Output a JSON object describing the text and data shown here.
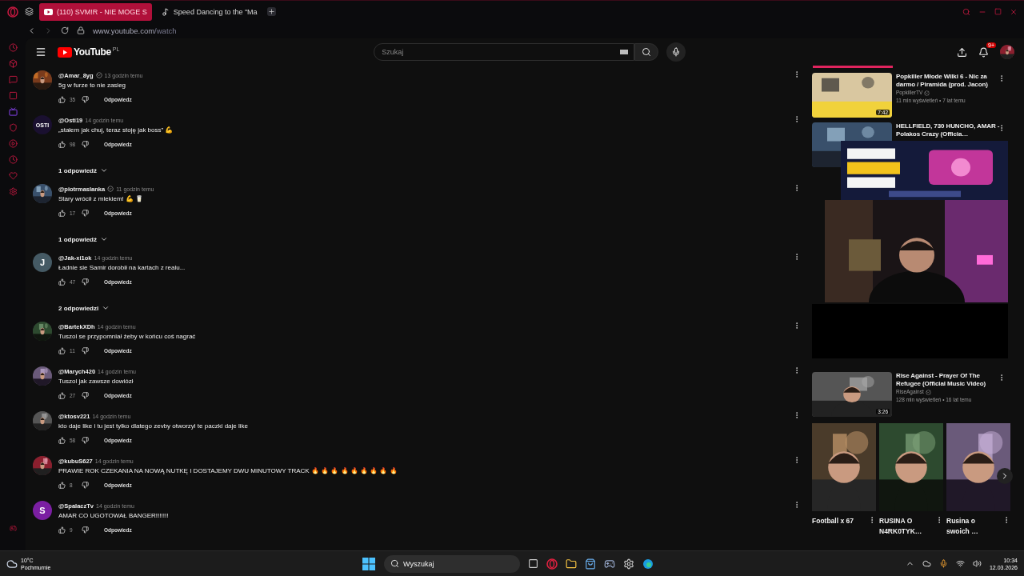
{
  "browser": {
    "tabs": [
      {
        "title": "(110) SVM!R - NIE MOGE S",
        "selected": true,
        "kind": "youtube"
      },
      {
        "title": "Speed Dancing to the \"Ma",
        "selected": false,
        "kind": "tiktok"
      }
    ],
    "url_host": "www.youtube.com",
    "url_path": "/watch"
  },
  "header": {
    "logo": "YouTube",
    "region": "PL",
    "search_placeholder": "Szukaj",
    "notifications": "9+"
  },
  "comments": [
    {
      "author": "@Amar_8yg",
      "verified": true,
      "time": "13 godzin temu",
      "text": "5g w furze to nie zasieg",
      "likes": "35",
      "reply": "Odpowiedz"
    },
    {
      "author": "@Osti19",
      "verified": false,
      "time": "14 godzin temu",
      "text": "„stałem jak chuj, teraz stoję jak boss” 💪",
      "likes": "98",
      "reply": "Odpowiedz",
      "avatar": {
        "kind": "text",
        "label": "OSTI",
        "color": "#1a1030"
      },
      "replies": "1 odpowiedź"
    },
    {
      "author": "@piotrmaslanka",
      "verified": true,
      "time": "11 godzin temu",
      "text": "Stary wrócił z mlekiem! 💪 🥛",
      "likes": "17",
      "reply": "Odpowiedz",
      "replies": "1 odpowiedź"
    },
    {
      "author": "@Jak-xi1ok",
      "verified": false,
      "time": "14 godzin temu",
      "text": "Ładnie sie Samir dorobił na kartach z realu...",
      "likes": "47",
      "reply": "Odpowiedz",
      "avatar": {
        "kind": "text",
        "label": "J",
        "color": "#455a64"
      },
      "replies": "2 odpowiedzi"
    },
    {
      "author": "@BartekXDh",
      "verified": false,
      "time": "14 godzin temu",
      "text": "Tuszol se przypomniał żeby w końcu coś nagrać",
      "likes": "11",
      "reply": "Odpowiedz"
    },
    {
      "author": "@Marych420",
      "verified": false,
      "time": "14 godzin temu",
      "text": "Tuszol jak zawsze dowiózł",
      "likes": "27",
      "reply": "Odpowiedz"
    },
    {
      "author": "@ktosv221",
      "verified": false,
      "time": "14 godzin temu",
      "text": "kto daje like i tu jest tylko dlatego zevby otworzyl te paczki daje like",
      "likes": "58",
      "reply": "Odpowiedz"
    },
    {
      "author": "@kubuS627",
      "verified": false,
      "time": "14 godzin temu",
      "text": "PRAWIE ROK CZEKANIA NA NOWĄ NUTKĘ I DOSTAJEMY DWU MINUTOWY TRACK 🔥 🔥 🔥 🔥 🔥 🔥 🔥 🔥 🔥",
      "likes": "8",
      "reply": "Odpowiedz"
    },
    {
      "author": "@SpalaczTv",
      "verified": false,
      "time": "14 godzin temu",
      "text": "AMAR CO UGOTOWAŁ BANGER!!!!!!!",
      "likes": "9",
      "reply": "Odpowiedz",
      "avatar": {
        "kind": "text",
        "label": "S",
        "color": "#7b1fa2"
      }
    }
  ],
  "sidebar": {
    "videos": [
      {
        "title": "Popkiller Młode Wilki 6 - Nic za darmo / Piramida (prod. Jacon)",
        "channel": "PopkillerTV",
        "verified": true,
        "meta": "11 mln wyświetleń • 7 lat temu",
        "duration": "7:42"
      },
      {
        "title": "HELLFIELD, 730 HUNCHO, AMAR - Polakos Crazy (Officia…"
      },
      {
        "title": "Rise Against - Prayer Of The Refugee (Official Music Video)",
        "channel": "RiseAgainst",
        "verified": true,
        "meta": "128 mln wyświetleń • 16 lat temu",
        "duration": "3:26"
      }
    ],
    "shorts": [
      {
        "title": "Football x 67"
      },
      {
        "title": "RUSINA O N4RK0TYK…"
      },
      {
        "title": "Rusina o swoich …"
      }
    ]
  },
  "taskbar": {
    "temperature": "10°C",
    "weather": "Pochmurnie",
    "search_placeholder": "Wyszukaj",
    "time": "10:34",
    "date": "12.03.2026"
  }
}
